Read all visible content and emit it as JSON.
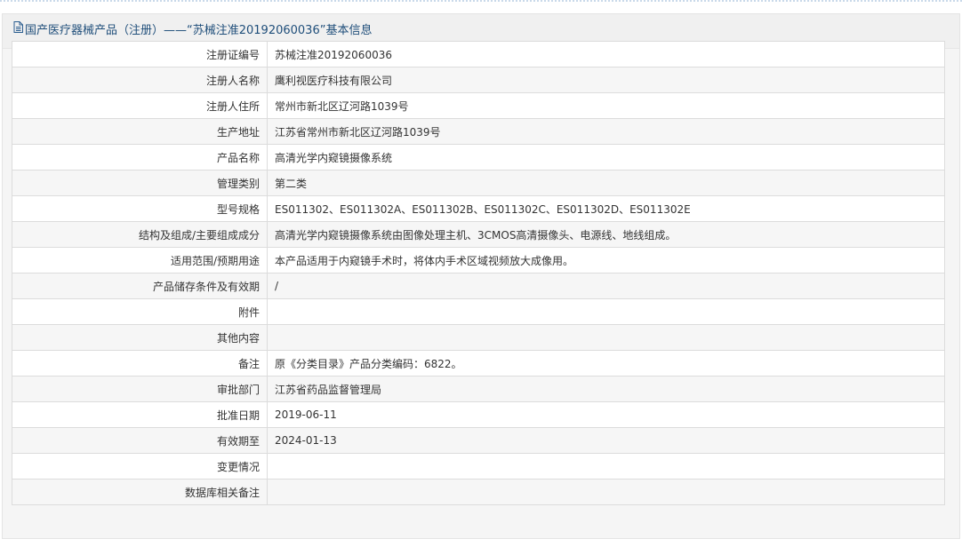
{
  "header": {
    "title": "国产医疗器械产品（注册）——“苏械注准20192060036”基本信息"
  },
  "rows": [
    {
      "label": "注册证编号",
      "value": "苏械注准20192060036"
    },
    {
      "label": "注册人名称",
      "value": "鹰利视医疗科技有限公司"
    },
    {
      "label": "注册人住所",
      "value": "常州市新北区辽河路1039号"
    },
    {
      "label": "生产地址",
      "value": "江苏省常州市新北区辽河路1039号"
    },
    {
      "label": "产品名称",
      "value": "高清光学内窥镜摄像系统"
    },
    {
      "label": "管理类别",
      "value": "第二类"
    },
    {
      "label": "型号规格",
      "value": "ES011302、ES011302A、ES011302B、ES011302C、ES011302D、ES011302E"
    },
    {
      "label": "结构及组成/主要组成成分",
      "value": "高清光学内窥镜摄像系统由图像处理主机、3CMOS高清摄像头、电源线、地线组成。"
    },
    {
      "label": "适用范围/预期用途",
      "value": "本产品适用于内窥镜手术时，将体内手术区域视频放大成像用。"
    },
    {
      "label": "产品储存条件及有效期",
      "value": "/"
    },
    {
      "label": "附件",
      "value": ""
    },
    {
      "label": "其他内容",
      "value": ""
    },
    {
      "label": "备注",
      "value": "原《分类目录》产品分类编码：6822。"
    },
    {
      "label": "审批部门",
      "value": "江苏省药品监督管理局"
    },
    {
      "label": "批准日期",
      "value": "2019-06-11"
    },
    {
      "label": "有效期至",
      "value": "2024-01-13"
    },
    {
      "label": "变更情况",
      "value": ""
    },
    {
      "label": "数据库相关备注",
      "value": ""
    }
  ]
}
